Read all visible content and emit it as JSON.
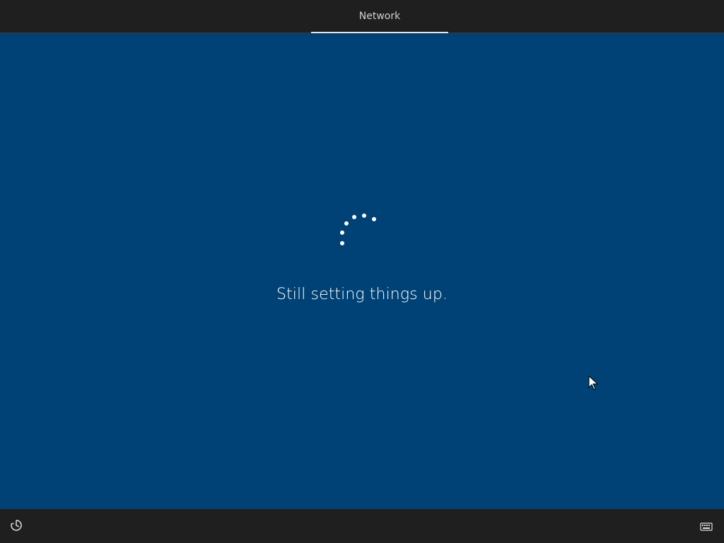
{
  "header": {
    "tabs": [
      {
        "label": "Network",
        "active": true
      }
    ]
  },
  "main": {
    "status_text": "Still setting things up."
  },
  "footer": {
    "left_icon": "ease-of-access-icon",
    "right_icon": "keyboard-icon"
  },
  "colors": {
    "background": "#004275",
    "bars": "#1f1f1f",
    "text": "#ffffff",
    "tab_text": "#d0d0d0"
  }
}
